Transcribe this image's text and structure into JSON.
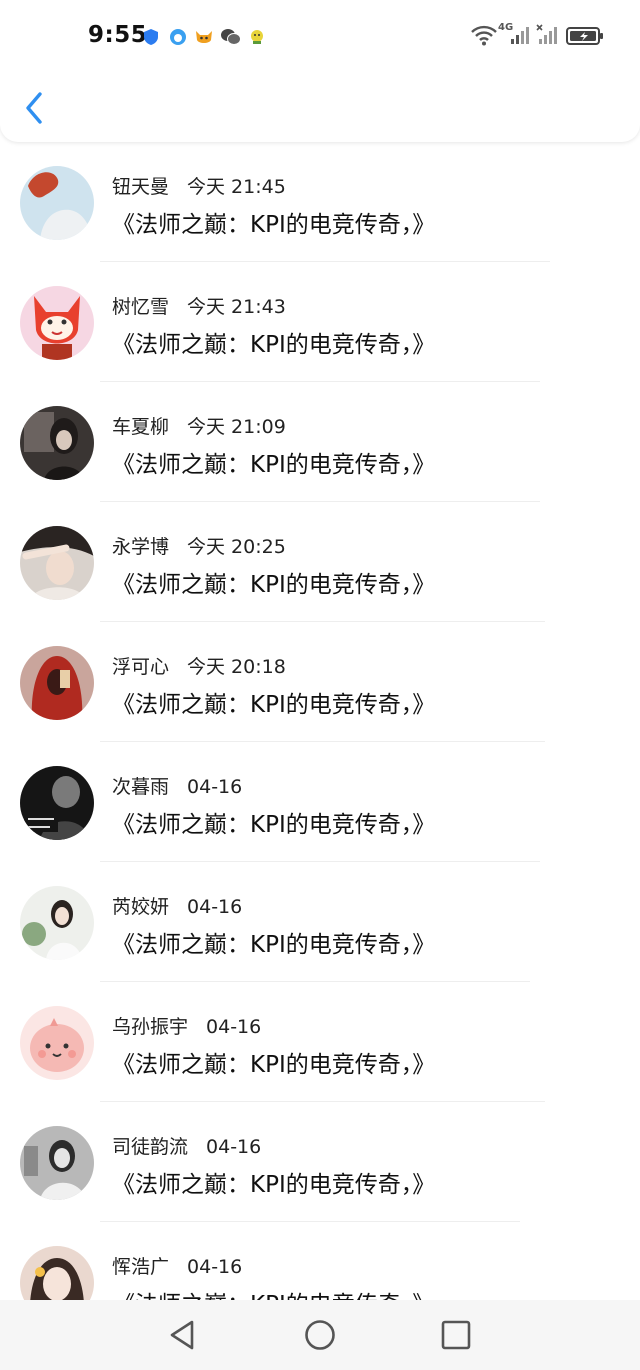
{
  "status_bar": {
    "time": "9:55",
    "network": "4G",
    "icons": [
      "shield-icon",
      "cloud-app-icon",
      "fox-app-icon",
      "wechat-icon",
      "bird-app-icon",
      "wifi-icon",
      "signal-icon",
      "signal-x-icon",
      "battery-charging-icon"
    ]
  },
  "header": {
    "back_icon": "chevron-left-icon",
    "accent_color": "#2f8ff0"
  },
  "comments": [
    {
      "name": "钮天曼",
      "time": "今天 21:45",
      "message": "《法师之巅：KPI的电竞传奇，》"
    },
    {
      "name": "树忆雪",
      "time": "今天 21:43",
      "message": "《法师之巅：KPI的电竞传奇，》"
    },
    {
      "name": "车夏柳",
      "time": "今天 21:09",
      "message": "《法师之巅：KPI的电竞传奇，》"
    },
    {
      "name": "永学博",
      "time": "今天 20:25",
      "message": "《法师之巅：KPI的电竞传奇，》"
    },
    {
      "name": "浮可心",
      "time": "今天 20:18",
      "message": "《法师之巅：KPI的电竞传奇，》"
    },
    {
      "name": "次暮雨",
      "time": "04-16",
      "message": "《法师之巅：KPI的电竞传奇，》"
    },
    {
      "name": "芮姣妍",
      "time": "04-16",
      "message": "《法师之巅：KPI的电竞传奇，》"
    },
    {
      "name": "乌孙振宇",
      "time": "04-16",
      "message": "《法师之巅：KPI的电竞传奇，》"
    },
    {
      "name": "司徒韵流",
      "time": "04-16",
      "message": "《法师之巅：KPI的电竞传奇，》"
    },
    {
      "name": "恽浩广",
      "time": "04-16",
      "message": "《法师之巅：KPI的电竞传奇，》"
    }
  ],
  "nav": {
    "icons": [
      "back-triangle-icon",
      "home-circle-icon",
      "recents-square-icon"
    ]
  }
}
